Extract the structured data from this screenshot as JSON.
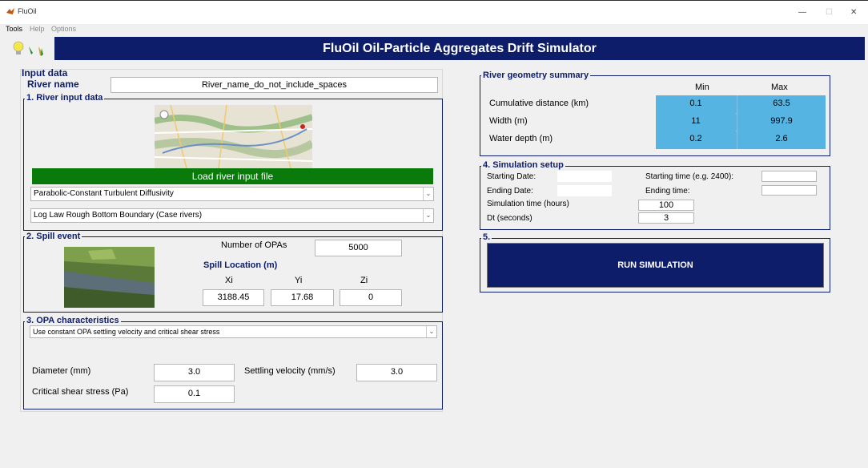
{
  "window": {
    "title": "FluOil"
  },
  "menu": [
    "Tools",
    "Help",
    "Options"
  ],
  "banner": "FluOil  Oil-Particle Aggregates Drift Simulator",
  "input_data": {
    "header": "Input data",
    "river_name_label": "River name",
    "river_name_value": "River_name_do_not_include_spaces"
  },
  "river_input": {
    "title": "1.  River input data",
    "load_button": "Load river input file",
    "diffusivity_select": "Parabolic-Constant Turbulent Diffusivity",
    "boundary_select": "Log Law Rough Bottom Boundary (Case rivers)"
  },
  "spill": {
    "title": "2.  Spill event",
    "num_opas_label": "Number of OPAs",
    "num_opas_value": "5000",
    "location_label": "Spill Location (m)",
    "xi_label": "Xi",
    "yi_label": "Yi",
    "zi_label": "Zi",
    "xi": "3188.45",
    "yi": "17.68",
    "zi": "0"
  },
  "opa": {
    "title": "3.  OPA characteristics",
    "method_select": "Use constant OPA settling velocity and critical shear stress",
    "diameter_label": "Diameter (mm)",
    "diameter": "3.0",
    "settling_label": "Settling velocity (mm/s)",
    "settling": "3.0",
    "shear_label": "Critical shear stress (Pa)",
    "shear": "0.1"
  },
  "geometry": {
    "title": "River geometry summary",
    "min_header": "Min",
    "max_header": "Max",
    "rows": [
      {
        "label": "Cumulative distance (km)",
        "min": "0.1",
        "max": "63.5"
      },
      {
        "label": "Width (m)",
        "min": "11",
        "max": "997.9"
      },
      {
        "label": "Water depth (m)",
        "min": "0.2",
        "max": "2.6"
      }
    ]
  },
  "simulation_setup": {
    "title": "4. Simulation setup",
    "starting_date_label": "Starting Date:",
    "ending_date_label": "Ending Date:",
    "starting_time_label": "Starting time (e.g. 2400):",
    "ending_time_label": "Ending time:",
    "sim_time_label": "Simulation time (hours)",
    "sim_time": "100",
    "dt_label": "Dt (seconds)",
    "dt": "3"
  },
  "run_panel": {
    "title": "5.",
    "button": "RUN SIMULATION"
  },
  "colors": {
    "banner": "#0d1d6a",
    "load_button": "#0a7a0a",
    "table_cell": "#56b4e3"
  }
}
